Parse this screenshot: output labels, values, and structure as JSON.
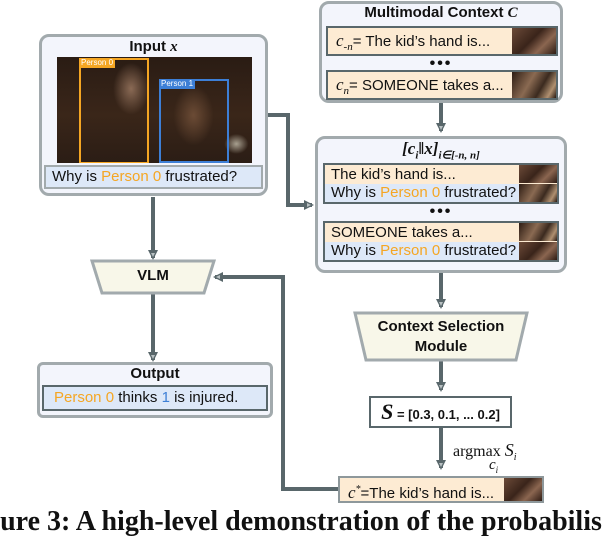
{
  "input_panel": {
    "title_text": "Input ",
    "title_var": "x",
    "bbox_labels": [
      "Person 0",
      "Person 1"
    ],
    "bbox_colors": [
      "#f5a623",
      "#3d7fd6"
    ],
    "question": {
      "prefix": "Why is ",
      "highlight": "Person 0",
      "suffix": " frustrated?"
    }
  },
  "context_panel": {
    "title_text": "Multimodal Context ",
    "title_var": "C",
    "items": [
      {
        "var": "c",
        "sub": "-n",
        "text": "= The kid’s hand is..."
      },
      {
        "var": "c",
        "sub": "n",
        "text": "= SOMEONE takes a..."
      }
    ],
    "ellipsis": "•••"
  },
  "concat_panel": {
    "title_main": "[c",
    "title_sub_i": "i",
    "title_mid": "‖x]",
    "title_range": "i∈[-n, n]",
    "pairs": [
      {
        "context": "The kid’s hand is...",
        "question": {
          "prefix": "Why is ",
          "highlight": "Person 0",
          "suffix": " frustrated?"
        }
      },
      {
        "context": "SOMEONE takes a...",
        "question": {
          "prefix": "Why is ",
          "highlight": "Person 0",
          "suffix": " frustrated?"
        }
      }
    ],
    "ellipsis": "•••"
  },
  "vlm": {
    "label": "VLM"
  },
  "csm": {
    "label_line1": "Context Selection",
    "label_line2": "Module"
  },
  "scores": {
    "var": "S",
    "text": " = [0.3, 0.1, ... 0.2]"
  },
  "argmax": {
    "op": "argmax",
    "var": "S",
    "sub": "i",
    "under": "c",
    "under_sub": "i"
  },
  "selected": {
    "var": "c",
    "sup": "*",
    "text": "=The kid’s hand is..."
  },
  "output_panel": {
    "title": "Output",
    "answer": {
      "p1": "Person 0",
      "p2": " thinks ",
      "p3": "1",
      "p4": " is injured."
    }
  },
  "caption": "ure 3: A high-level demonstration of the probabilis",
  "colors": {
    "wire": "#59676b",
    "panel_border": "#a2aaad",
    "accent_orange": "#f5a623",
    "accent_blue": "#3d7fd6"
  }
}
